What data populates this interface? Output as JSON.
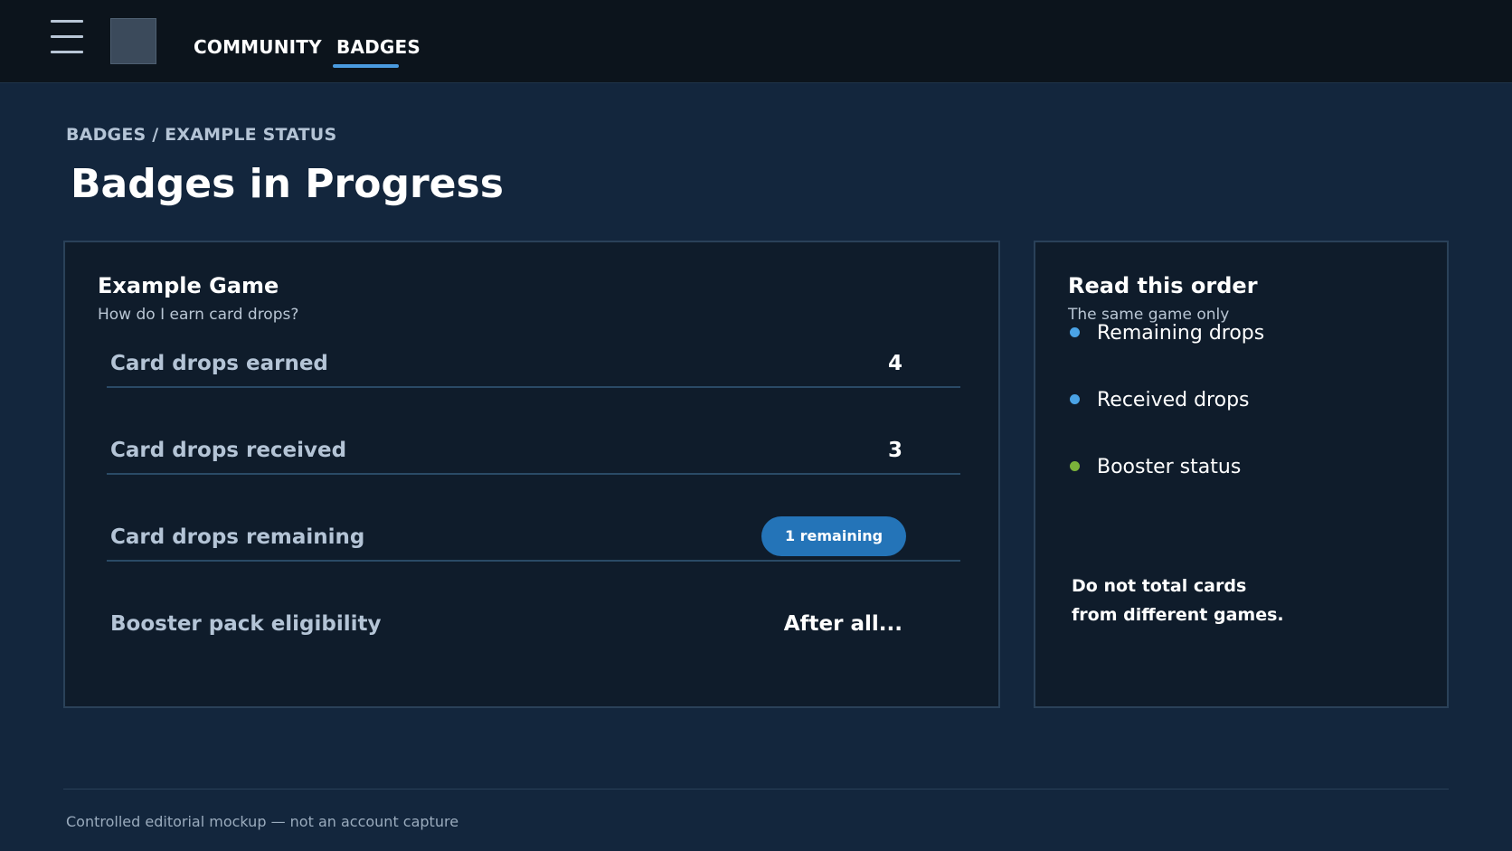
{
  "nav": {
    "community": "COMMUNITY",
    "badges": "BADGES"
  },
  "breadcrumb": "BADGES / EXAMPLE STATUS",
  "page_title": "Badges in Progress",
  "game": {
    "title": "Example Game",
    "help_link": "How do I earn card drops?",
    "rows": [
      {
        "label": "Card drops earned",
        "value": "4"
      },
      {
        "label": "Card drops received",
        "value": "3"
      },
      {
        "label": "Card drops remaining",
        "value": "1 remaining"
      },
      {
        "label": "Booster pack eligibility",
        "value": "After all..."
      }
    ]
  },
  "sidebar": {
    "title": "Read this order",
    "subtitle": "The same game only",
    "items": [
      {
        "label": "Remaining drops",
        "color": "#4aa3e6"
      },
      {
        "label": "Received drops",
        "color": "#4aa3e6"
      },
      {
        "label": "Booster status",
        "color": "#7bb33a"
      }
    ],
    "note_line1": "Do not total cards",
    "note_line2": "from different games."
  },
  "colors": {
    "accent": "#4a9be0",
    "pill": "#2474b8"
  },
  "footer": "Controlled editorial mockup — not an account capture"
}
